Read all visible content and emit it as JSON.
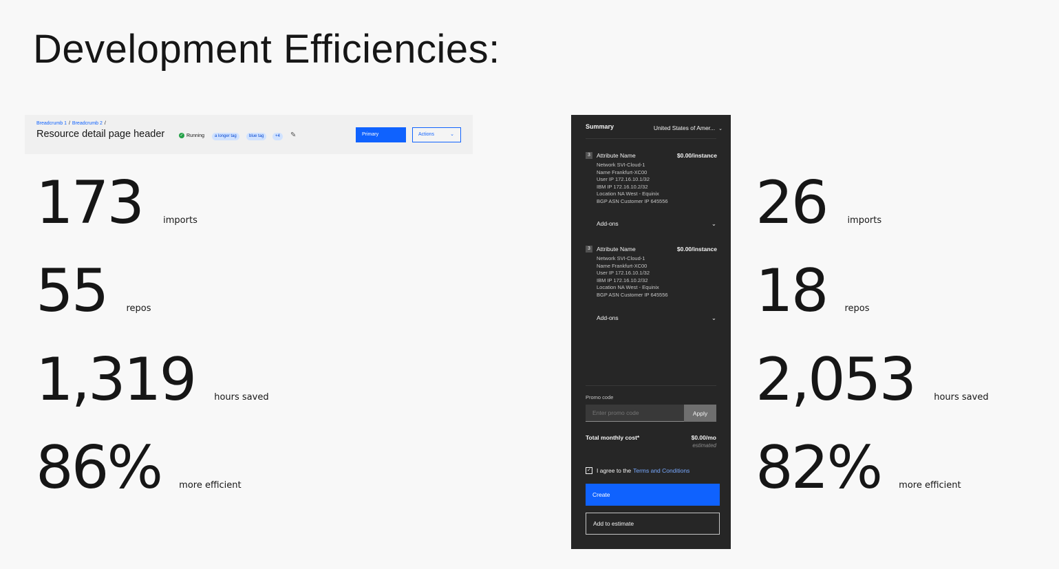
{
  "page": {
    "title": "Development Efficiencies:"
  },
  "resource_header": {
    "breadcrumbs": [
      "Breadcrumb 1",
      "Breadcrumb 2"
    ],
    "breadcrumb_separator": "/",
    "title": "Resource detail page header",
    "status": {
      "icon": "checkmark-filled-icon",
      "label": "Running",
      "color": "#24a148"
    },
    "tags": [
      "a longer tag",
      "blue tag",
      "+4"
    ],
    "edit_icon": "pencil-icon",
    "primary_label": "Primary",
    "actions_label": "Actions"
  },
  "left_stats": [
    {
      "value": "173",
      "label": "imports"
    },
    {
      "value": "55",
      "label": "repos"
    },
    {
      "value": "1,319",
      "label": "hours saved"
    },
    {
      "value": "86%",
      "label": "more efficient"
    }
  ],
  "right_stats": [
    {
      "value": "26",
      "label": "imports"
    },
    {
      "value": "18",
      "label": "repos"
    },
    {
      "value": "2,053",
      "label": "hours saved"
    },
    {
      "value": "82%",
      "label": "more efficient"
    }
  ],
  "summary": {
    "heading": "Summary",
    "region": "United States of Amer...",
    "items": [
      {
        "count": "3",
        "name": "Attribute Name",
        "price": "$0.00/instance",
        "details": [
          "Network  SVI-Cloud-1",
          "Name  Frankfurt-XC00",
          "User IP  172.16.10.1/32",
          "IBM IP  172.16.10.2/32",
          "Location  NA West - Equinix",
          "BGP ASN  Customer IP 645556"
        ],
        "addons_label": "Add-ons"
      },
      {
        "count": "3",
        "name": "Attribute Name",
        "price": "$0.00/instance",
        "details": [
          "Network  SVI-Cloud-1",
          "Name  Frankfurt-XC00",
          "User IP  172.16.10.1/32",
          "IBM IP  172.16.10.2/32",
          "Location  NA West - Equinix",
          "BGP ASN  Customer IP 645556"
        ],
        "addons_label": "Add-ons"
      }
    ],
    "promo_label": "Promo code",
    "promo_placeholder": "Enter promo code",
    "apply_label": "Apply",
    "total_label": "Total monthly cost*",
    "total_value": "$0.00/mo",
    "total_note": "estimated",
    "agree_text": "I agree to the",
    "agree_link": "Terms and Conditions",
    "agree_checked": true,
    "create_label": "Create",
    "add_estimate_label": "Add to estimate"
  },
  "colors": {
    "brand_blue": "#0f62fe",
    "panel_bg": "#262626",
    "tag_bg": "#d0e2ff",
    "link": "#78a9ff"
  }
}
